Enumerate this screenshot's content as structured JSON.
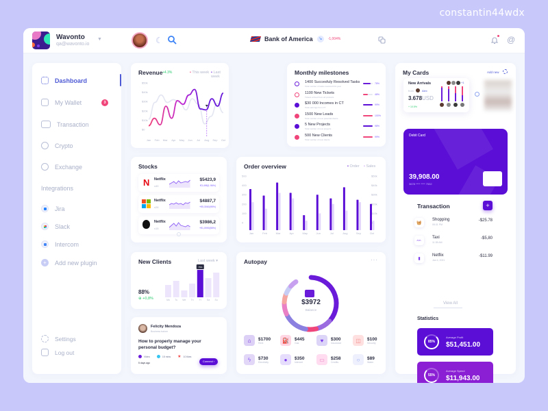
{
  "watermark": "constantin44wdx",
  "topbar": {
    "brand_name": "Wavonto",
    "brand_email": "qa@wavonto.io",
    "bank_name": "Bank of America",
    "bank_change": "-1,004%"
  },
  "sidebar": {
    "items": [
      {
        "label": "Dashboard",
        "icon": "grid-icon",
        "active": true
      },
      {
        "label": "My Wallet",
        "icon": "wallet-icon",
        "badge": "3"
      },
      {
        "label": "Transaction",
        "icon": "cash-icon"
      },
      {
        "label": "Crypto",
        "icon": "coin-icon"
      },
      {
        "label": "Exchange",
        "icon": "exchange-icon"
      }
    ],
    "integrations_title": "Integrations",
    "integrations": [
      {
        "label": "Jira"
      },
      {
        "label": "Slack"
      },
      {
        "label": "Intercom"
      },
      {
        "label": "Add new plugin"
      }
    ],
    "settings": "Settings",
    "logout": "Log out"
  },
  "revenue": {
    "title": "Revenue",
    "change": "+4.3%",
    "legend_this": "This week",
    "legend_last": "Last week",
    "chart_data": {
      "type": "line",
      "title": "Revenue",
      "categories": [
        "Jan",
        "Feb",
        "Mar",
        "Apr",
        "May",
        "Jun",
        "Jul",
        "Aug",
        "Sep",
        "Oct"
      ],
      "yticks": [
        "$50k",
        "$40k",
        "$30k",
        "$20k",
        "$10k",
        "$0"
      ],
      "ylim": [
        0,
        50000
      ],
      "series": [
        {
          "name": "This week",
          "values": [
            4000,
            12000,
            5000,
            25000,
            12000,
            31000,
            27000,
            37000,
            43000,
            22000,
            21000,
            33000,
            25000,
            39000
          ]
        },
        {
          "name": "Last week",
          "values": [
            11000,
            29000,
            37000,
            29000,
            32000,
            29000,
            21000,
            33000,
            27000,
            6000,
            14000,
            28000,
            18000
          ]
        }
      ],
      "highlight": "Aug"
    }
  },
  "milestones": {
    "title": "Monthly milestones",
    "items": [
      {
        "title": "1400 Succesfuly Resolved Tasks",
        "sub": "Total number of tasks resolved this year",
        "pct": "78%",
        "value": 0.78,
        "color": "#6a1bd9",
        "filled": false
      },
      {
        "title": "1100 New Tickets",
        "sub": "Tickets arrived from all products",
        "pct": "48%",
        "value": 0.48,
        "color": "#f0457a",
        "filled": false
      },
      {
        "title": "$30 000 Incomes in CT",
        "sub": "Total earnings from CT",
        "pct": "99%",
        "value": 0.99,
        "color": "#5b0fd6",
        "filled": true
      },
      {
        "title": "1500 New Leads",
        "sub": "Total number of new potential clients",
        "pct": "100%",
        "value": 1.0,
        "color": "#f0457a",
        "filled": true
      },
      {
        "title": "5 New Projects",
        "sub": "Total number of new projects",
        "pct": "98%",
        "value": 0.98,
        "color": "#5b0fd6",
        "filled": true
      },
      {
        "title": "500 New Clients",
        "sub": "Total number of new clients",
        "pct": "99%",
        "value": 0.99,
        "color": "#f0457a",
        "filled": true
      }
    ]
  },
  "mycards": {
    "title": "My Cards",
    "add_new": "Add new",
    "new_arrivals": "New Arrivals",
    "arrivals_more": "+1",
    "from_label": "from",
    "from_name": "Alex",
    "amount": "3.678",
    "currency": "USD",
    "change": "+ 10.5%",
    "debit": {
      "label": "Debit Card",
      "balance": "39,908.00",
      "number": "3678 **** **** 7532"
    }
  },
  "transactions": {
    "title": "Transaction",
    "items": [
      {
        "name": "Shopping",
        "time": "05:31 PM",
        "amount": "-$25.78",
        "icon": "basket-icon"
      },
      {
        "name": "Taxi",
        "time": "11:35 AM",
        "amount": "-$5,80",
        "icon": "taxi-icon"
      },
      {
        "name": "Netflix",
        "time": "Jan 4, 2021",
        "amount": "-$11.99",
        "icon": "netflix-icon"
      }
    ],
    "view_all": "View All"
  },
  "statistics": {
    "title": "Statistics",
    "items": [
      {
        "label": "Average Profit",
        "value": "$51,451.00",
        "pct": "85%",
        "fraction": 0.85,
        "bg": "#5b0fd6"
      },
      {
        "label": "Average Spend",
        "value": "$11,943.00",
        "pct": "55%",
        "fraction": 0.55,
        "bg": "#8a1fd4"
      }
    ]
  },
  "stocks": {
    "title": "Stocks",
    "items": [
      {
        "name": "Netflix",
        "shares": "x40",
        "price": "$5423,9",
        "change": "€3,498(1.96%)",
        "logo": "netflix"
      },
      {
        "name": "Netflix",
        "shares": "x26",
        "price": "$4887,7",
        "change": "+€5,3060(95%)",
        "logo": "microsoft"
      },
      {
        "name": "Netflix",
        "shares": "x15",
        "price": "$3986,2",
        "change": "+€1,0990(55%)",
        "logo": "apple"
      }
    ]
  },
  "orders": {
    "title": "Order overview",
    "legend_order": "Order",
    "legend_sales": "Sales",
    "chart_data": {
      "type": "bar",
      "title": "Order overview",
      "categories": [
        "Jan",
        "Feb",
        "Mar",
        "Apr",
        "May",
        "Jun",
        "Jul",
        "Aug",
        "Sep",
        "Oct"
      ],
      "yticks_left": [
        "500",
        "400",
        "300",
        "200",
        "100",
        "0"
      ],
      "yticks_right": [
        "$50k",
        "$40k",
        "$30k",
        "$20k",
        "$10k",
        "$0"
      ],
      "series": [
        {
          "name": "Order",
          "values": [
            360,
            290,
            430,
            320,
            80,
            300,
            260,
            380,
            245,
            200
          ]
        },
        {
          "name": "Sales",
          "values": [
            22000,
            15000,
            32000,
            26000,
            2000,
            10000,
            20000,
            13000,
            22000,
            2000
          ]
        }
      ]
    }
  },
  "new_clients": {
    "title": "New Clients",
    "period": "Last week",
    "pct": "88%",
    "change": "+0,8%",
    "tooltip": "75%",
    "chart_data": {
      "type": "bar",
      "categories": [
        "Mo",
        "Tu",
        "We",
        "Th",
        "Fr",
        "Sa",
        "Su"
      ],
      "values": [
        45,
        60,
        25,
        50,
        100,
        70,
        90
      ],
      "highlight": "Fr"
    }
  },
  "felicity": {
    "name": "Felicity Mendoza",
    "role": "Business trainer",
    "question": "How to properly manage your personal budget?",
    "meta": [
      {
        "label": "Video",
        "icon": "video-icon"
      },
      {
        "label": "15 mins",
        "icon": "clock-icon"
      },
      {
        "label": "10 likes",
        "icon": "star-icon"
      }
    ],
    "ago": "5 days ago",
    "connect": "Connect"
  },
  "autopay": {
    "title": "Autopay",
    "balance": "$3972",
    "balance_label": "Balance",
    "segments": [
      {
        "name": "Rent",
        "color": "#6a1bd9",
        "value": 1700
      },
      {
        "name": "Gas",
        "color": "#9b6be0",
        "value": 445
      },
      {
        "name": "Insurance",
        "color": "#f0457a",
        "value": 300
      },
      {
        "name": "Security",
        "color": "#c7a1f0",
        "value": 100
      },
      {
        "name": "Electricity",
        "color": "#8b7fe0",
        "value": 730
      },
      {
        "name": "Internet",
        "color": "#e97fc4",
        "value": 350
      },
      {
        "name": "Credits",
        "color": "#f5a6a0",
        "value": 258
      },
      {
        "name": "Water",
        "color": "#c8cdf6",
        "value": 89
      }
    ],
    "tiles": [
      {
        "value": "$1700",
        "label": "Rent",
        "bg": "#dcd0f7",
        "fg": "#6a1bd9",
        "icon": "home-icon",
        "glyph": "⌂"
      },
      {
        "value": "$445",
        "label": "Gas",
        "bg": "#ffd6e3",
        "fg": "#f0457a",
        "icon": "gas-icon",
        "glyph": "⛽"
      },
      {
        "value": "$300",
        "label": "Insurance",
        "bg": "#ddd5f7",
        "fg": "#7c3aed",
        "icon": "heart-icon",
        "glyph": "♥"
      },
      {
        "value": "$100",
        "label": "Security",
        "bg": "#ffe0e0",
        "fg": "#f08a8a",
        "icon": "trash-icon",
        "glyph": "◫"
      },
      {
        "value": "$730",
        "label": "Electricity",
        "bg": "#e2d7f7",
        "fg": "#8b5cf6",
        "icon": "bolt-icon",
        "glyph": "ϟ"
      },
      {
        "value": "$350",
        "label": "Internet",
        "bg": "#e6dcfb",
        "fg": "#7c3aed",
        "icon": "globe-icon",
        "glyph": "●"
      },
      {
        "value": "$258",
        "label": "Credits",
        "bg": "#ffdcef",
        "fg": "#e97fc4",
        "icon": "card-icon",
        "glyph": "▭"
      },
      {
        "value": "$89",
        "label": "Water",
        "bg": "#eef0fd",
        "fg": "#8ea4f0",
        "icon": "drop-icon",
        "glyph": "○"
      }
    ]
  }
}
